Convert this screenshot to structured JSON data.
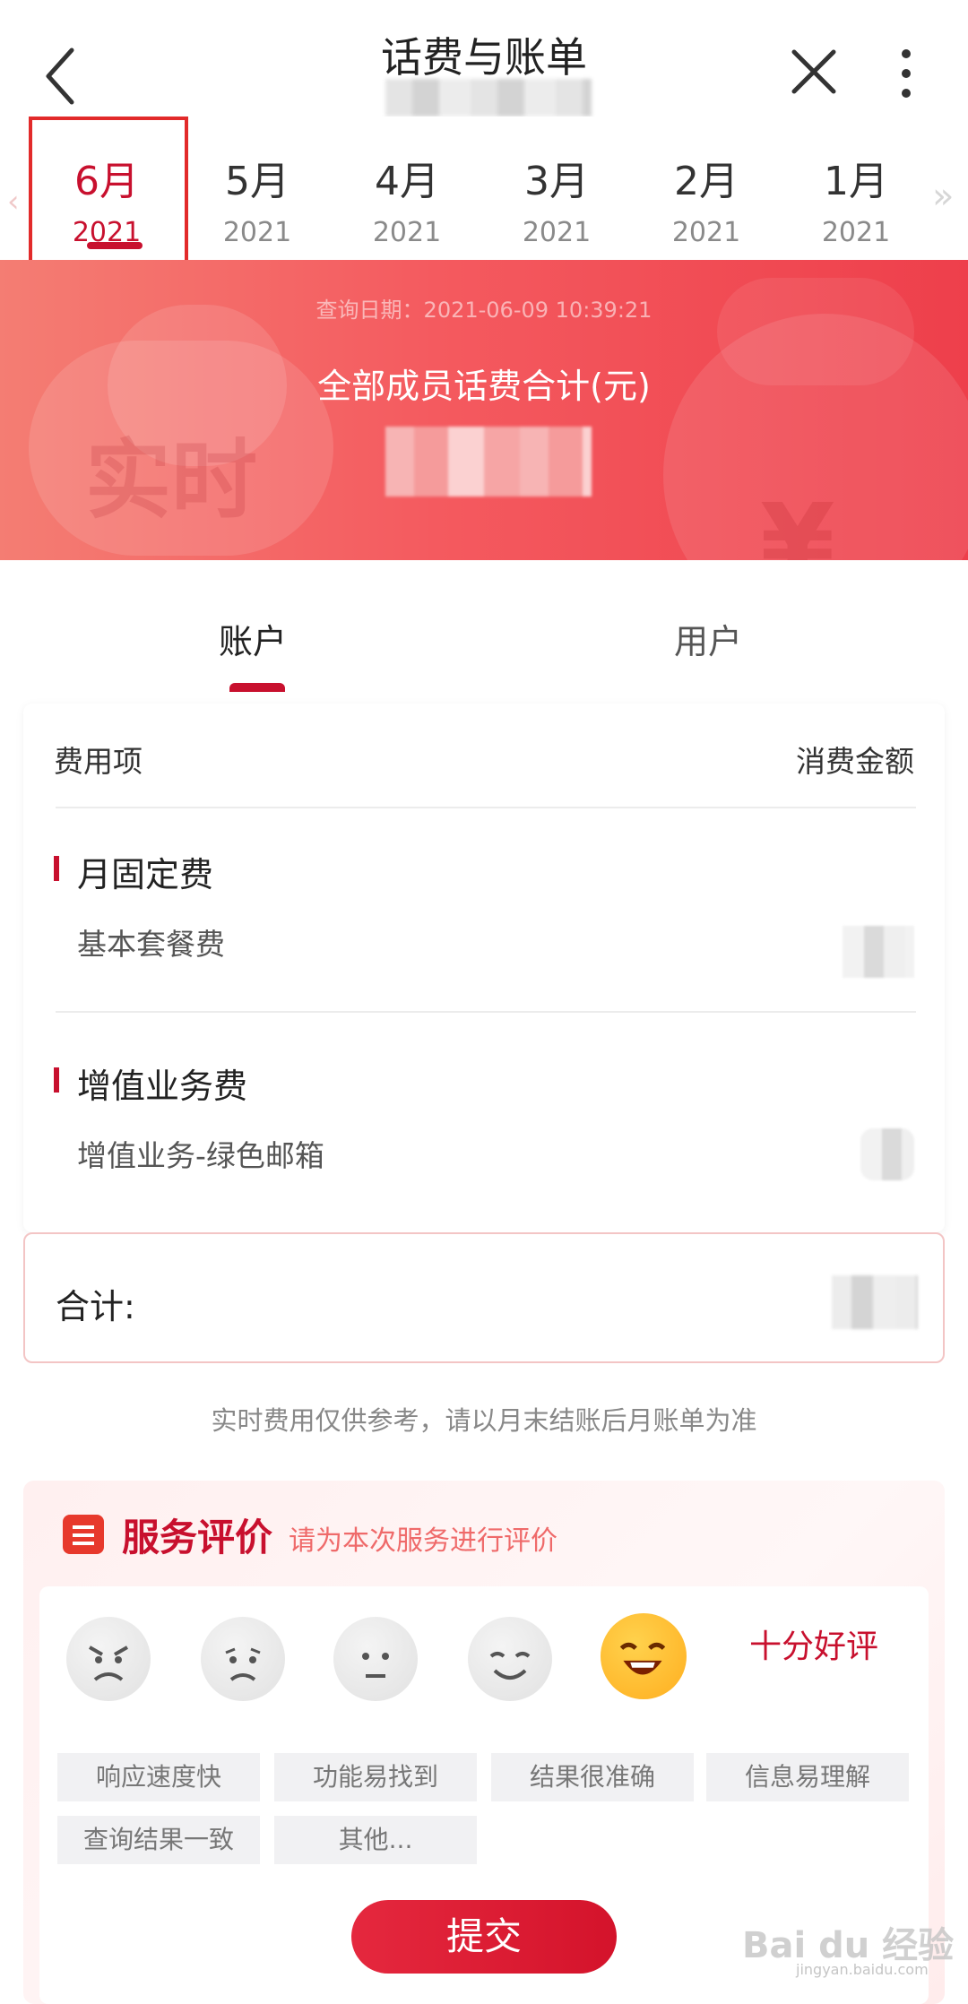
{
  "nav": {
    "title": "话费与账单"
  },
  "months": [
    {
      "m": "6月",
      "y": "2021"
    },
    {
      "m": "5月",
      "y": "2021"
    },
    {
      "m": "4月",
      "y": "2021"
    },
    {
      "m": "3月",
      "y": "2021"
    },
    {
      "m": "2月",
      "y": "2021"
    },
    {
      "m": "1月",
      "y": "2021"
    }
  ],
  "banner": {
    "query_date": "查询日期：2021-06-09 10:39:21",
    "label": "全部成员话费合计(元)",
    "watermark": "实时",
    "yen": "¥"
  },
  "tabs": {
    "account": "账户",
    "user": "用户"
  },
  "table": {
    "col_item": "费用项",
    "col_amount": "消费金额",
    "sections": [
      {
        "title": "月固定费",
        "item": "基本套餐费"
      },
      {
        "title": "增值业务费",
        "item": "增值业务-绿色邮箱"
      }
    ]
  },
  "total": {
    "label": "合计:"
  },
  "note": "实时费用仅供参考，请以月末结账后月账单为准",
  "evaluation": {
    "title": "服务评价",
    "subtitle": "请为本次服务进行评价",
    "selected_text": "十分好评",
    "chips": [
      "响应速度快",
      "功能易找到",
      "结果很准确",
      "信息易理解",
      "查询结果一致",
      "其他..."
    ],
    "submit": "提交"
  },
  "watermark": {
    "main": "Bai du 经验",
    "sub": "jingyan.baidu.com"
  },
  "arrows": {
    "left": "‹",
    "right": "»"
  }
}
